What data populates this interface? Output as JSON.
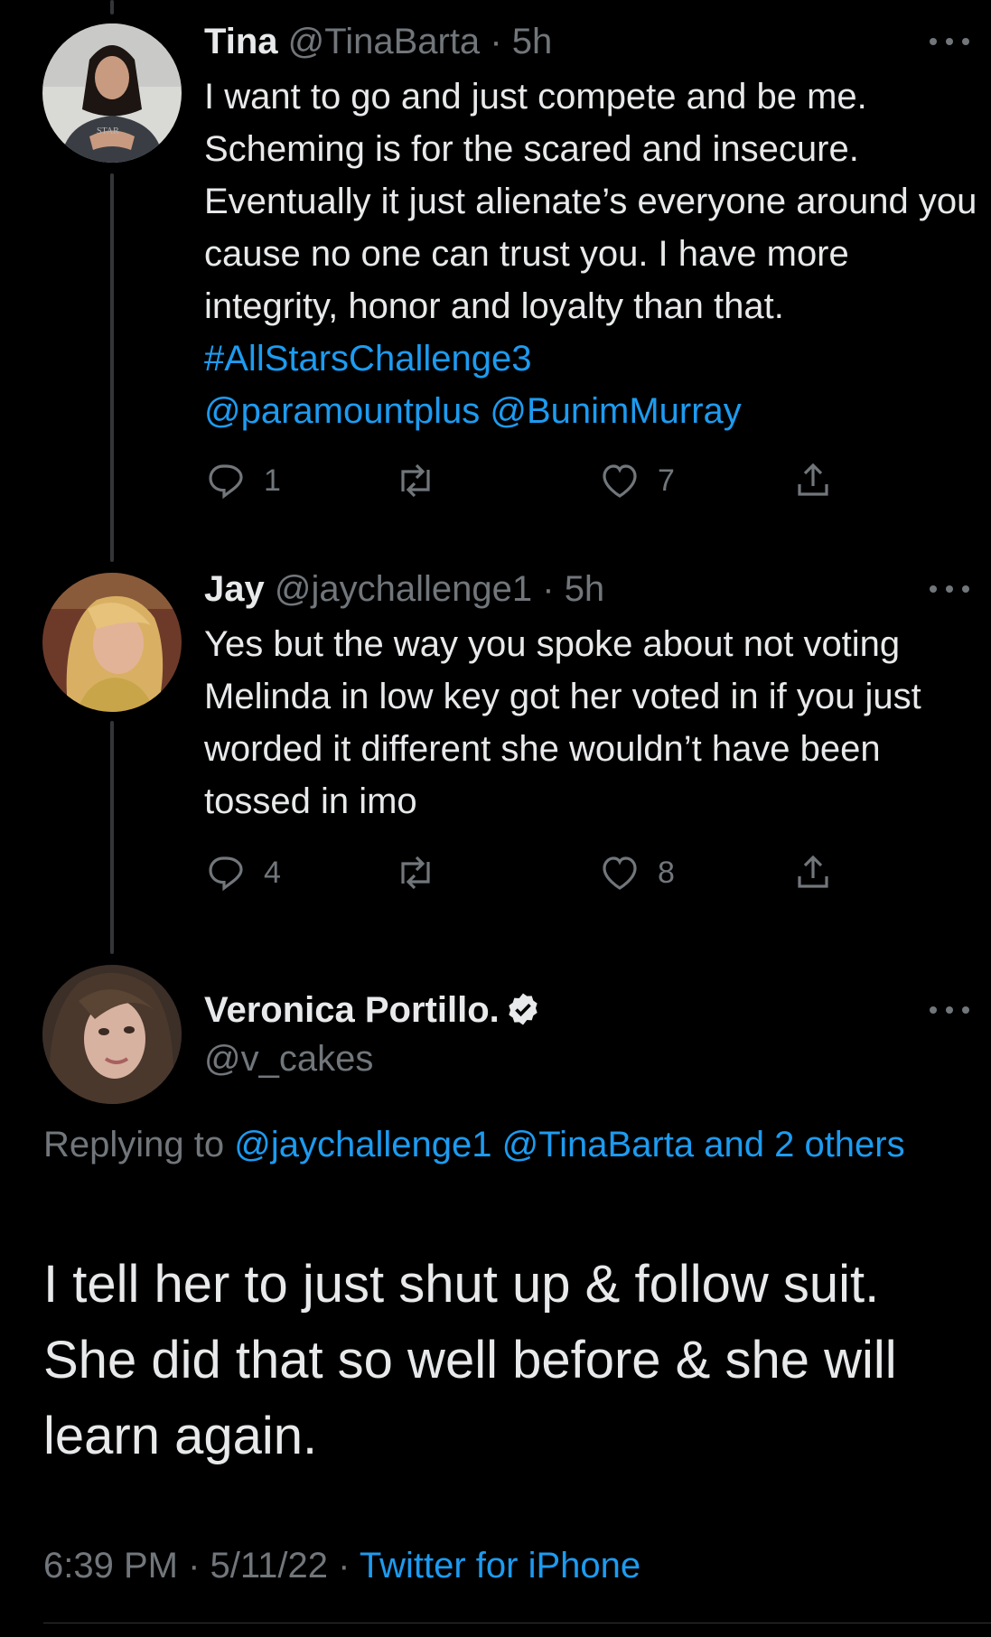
{
  "tweets": [
    {
      "display_name": "Tina",
      "handle": "@TinaBarta",
      "separator": "·",
      "time": "5h",
      "text_plain": "I want to go and just compete and be me. Scheming is for the scared and insecure. Eventually it just alienate’s everyone around you cause no one can trust you.  I have more integrity, honor and loyalty than that. ",
      "hashtag": "#AllStarsChallenge3",
      "mention1": "@paramountplus",
      "mention2": "@BunimMurray",
      "reply_count": "1",
      "retweet_count": "",
      "like_count": "7"
    },
    {
      "display_name": "Jay",
      "handle": "@jaychallenge1",
      "separator": "·",
      "time": "5h",
      "text_plain": "Yes but the way you spoke about not voting Melinda in low key got her voted in if you just worded it different she wouldn’t have been tossed in imo",
      "reply_count": "4",
      "retweet_count": "",
      "like_count": "8"
    }
  ],
  "main_tweet": {
    "display_name": "Veronica Portillo.",
    "handle": "@v_cakes",
    "replying_prefix": "Replying to ",
    "replying_mentions": "@jaychallenge1 @TinaBarta and 2 others",
    "text": "I tell her to just shut up & follow suit. She did that so well before & she will learn again.",
    "time": "6:39 PM",
    "separator": "·",
    "date": "5/11/22",
    "source": "Twitter for iPhone"
  },
  "icons": {
    "reply": "reply-icon",
    "retweet": "retweet-icon",
    "like": "heart-icon",
    "share": "share-icon",
    "more": "more-icon",
    "verified": "verified-badge-icon"
  },
  "colors": {
    "background": "#000000",
    "text": "#e7e9ea",
    "muted": "#71767b",
    "link": "#1d9bf0",
    "thread_line": "#333639"
  }
}
